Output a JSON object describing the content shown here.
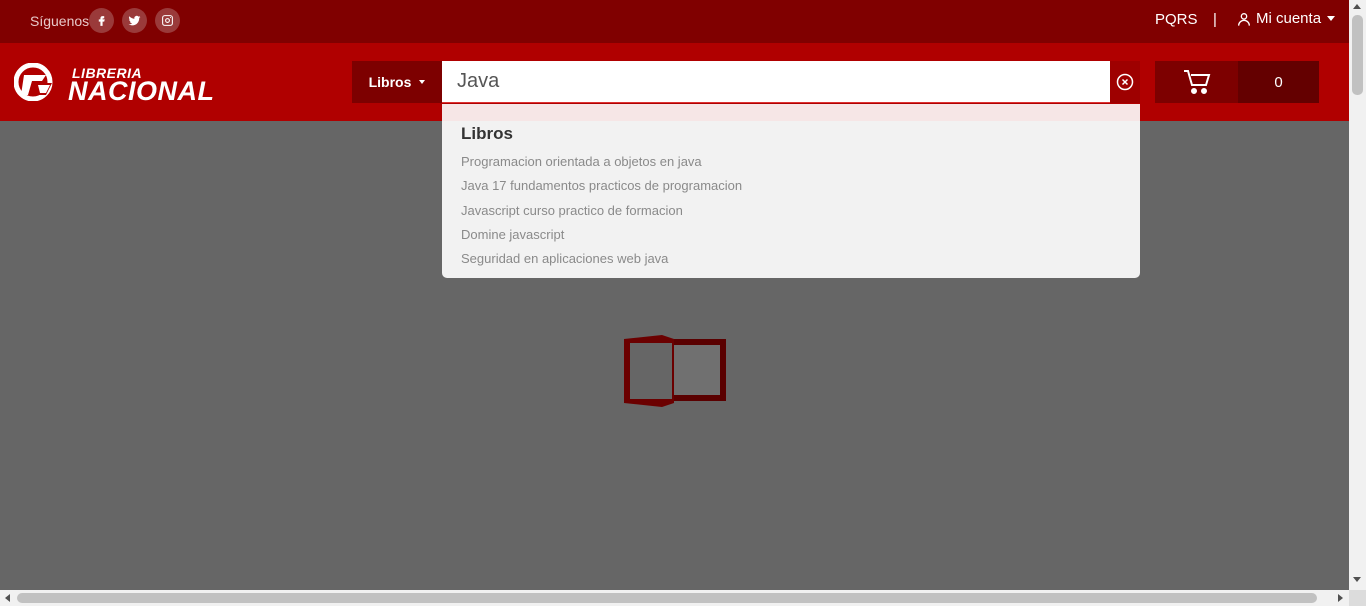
{
  "topbar": {
    "follow_label": "Síguenos",
    "social": [
      "facebook-icon",
      "twitter-icon",
      "instagram-icon"
    ],
    "pqrs_label": "PQRS",
    "separator": "|",
    "account_label": "Mi cuenta"
  },
  "header": {
    "logo_top": "LIBRERIA",
    "logo_bottom": "NACIONAL",
    "category_label": "Libros",
    "search_value": "Java",
    "cart_count": "0"
  },
  "dropdown": {
    "heading": "Libros",
    "items": [
      "Programacion orientada a objetos en java",
      "Java 17 fundamentos practicos de programacion",
      "Javascript curso practico de formacion",
      "Domine javascript",
      "Seguridad en aplicaciones web java"
    ]
  },
  "colors": {
    "topbar": "#800000",
    "header": "#b00000",
    "accent_dark": "#7d0000",
    "overlay": "#666666"
  }
}
